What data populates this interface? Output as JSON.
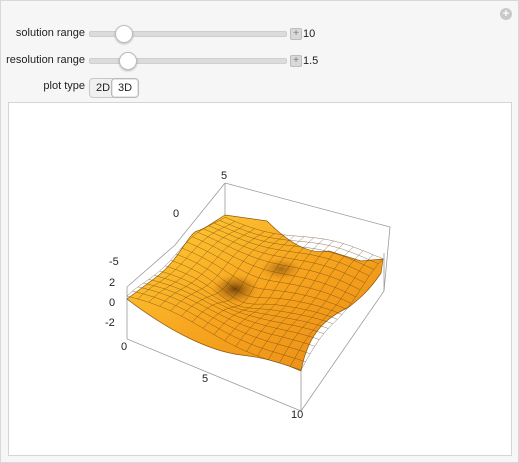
{
  "controls": {
    "solution_range": {
      "label": "solution range",
      "value": "10",
      "fraction": 0.18
    },
    "resolution_range": {
      "label": "resolution range",
      "value": "1.5",
      "fraction": 0.2
    },
    "plot_type": {
      "label": "plot type",
      "options": [
        "2D",
        "3D"
      ],
      "selected": "3D"
    }
  },
  "plot": {
    "surface_color": "#f5a21a",
    "mesh_color": "#5a3a10",
    "axis_labels": {
      "top_5": "5",
      "top_0": "0",
      "left_neg5": "-5",
      "z_2": "2",
      "z_0": "0",
      "z_neg2": "-2",
      "bottom_0": "0",
      "bottom_5": "5",
      "bottom_10": "10"
    }
  }
}
